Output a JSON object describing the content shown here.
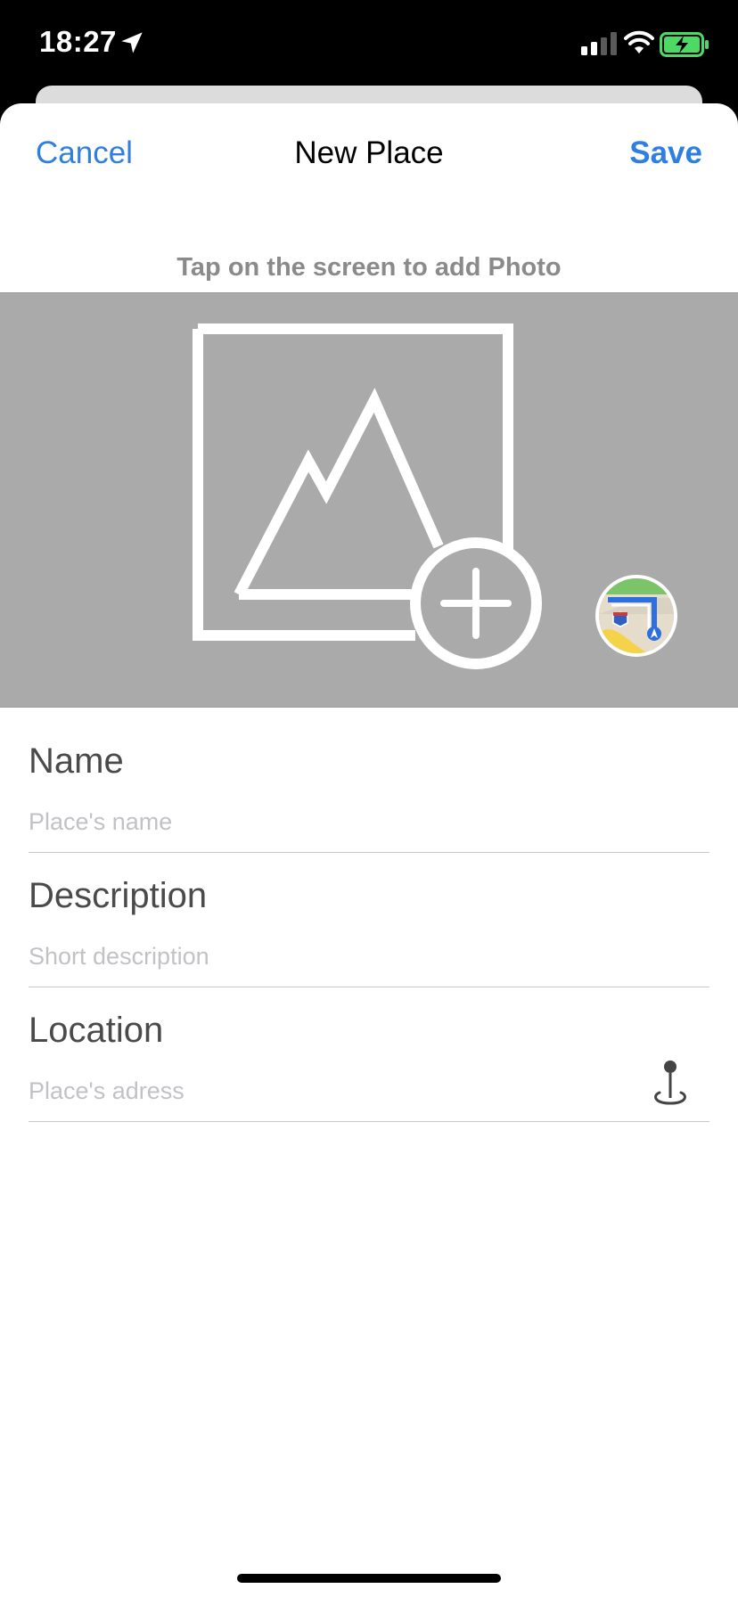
{
  "status_bar": {
    "time": "18:27",
    "icons": [
      "location-arrow-icon",
      "signal-icon",
      "wifi-icon",
      "battery-charging-icon"
    ]
  },
  "nav": {
    "cancel_label": "Cancel",
    "title": "New Place",
    "save_label": "Save"
  },
  "photo": {
    "hint": "Tap on the screen to add Photo",
    "icon": "add-photo-icon",
    "maps_icon": "maps-app-icon",
    "maps_shield_text": "280"
  },
  "form": {
    "name": {
      "label": "Name",
      "placeholder": "Place's name",
      "value": ""
    },
    "description": {
      "label": "Description",
      "placeholder": "Short description",
      "value": ""
    },
    "location": {
      "label": "Location",
      "placeholder": "Place's adress",
      "value": "",
      "icon": "map-pin-icon"
    }
  },
  "colors": {
    "accent": "#2f7fe0",
    "photo_background": "#aaaaaa",
    "hint_text": "#8a8a8a",
    "placeholder": "#c2c2c6"
  }
}
